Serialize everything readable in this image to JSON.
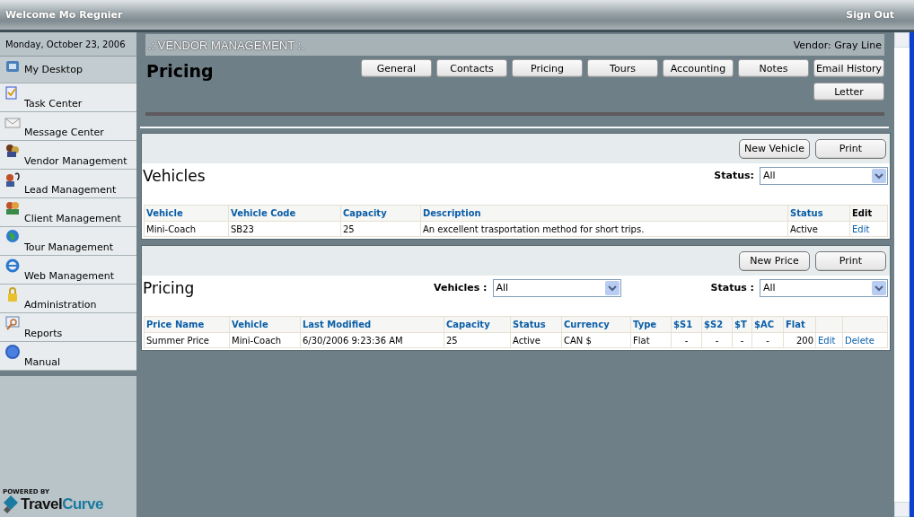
{
  "top_bar": {
    "welcome": "Welcome Mo Regnier",
    "sign_out": "Sign Out"
  },
  "sidebar": {
    "date": "Monday, October 23, 2006",
    "items": [
      {
        "label": "My Desktop",
        "selected": true
      },
      {
        "label": "Task Center",
        "selected": false
      },
      {
        "label": "Message Center",
        "selected": false
      },
      {
        "label": "Vendor Management",
        "selected": false
      },
      {
        "label": "Lead Management",
        "selected": false
      },
      {
        "label": "Client Management",
        "selected": false
      },
      {
        "label": "Tour Management",
        "selected": false
      },
      {
        "label": "Web Management",
        "selected": false
      },
      {
        "label": "Administration",
        "selected": false
      },
      {
        "label": "Reports",
        "selected": false
      },
      {
        "label": "Manual",
        "selected": false
      }
    ],
    "logo": {
      "caption": "POWERED BY",
      "parts": [
        "Travel",
        "Curve"
      ]
    }
  },
  "header": {
    "section": ".: VENDOR MANAGEMENT :.",
    "vendor": "Vendor: Gray Line",
    "title": "Pricing",
    "tabs": [
      "General",
      "Contacts",
      "Pricing",
      "Tours",
      "Accounting",
      "Notes",
      "Email History",
      "Letter"
    ]
  },
  "vehicles": {
    "buttons": [
      "New Vehicle",
      "Print"
    ],
    "title": "Vehicles",
    "filters": [
      {
        "label": "Status:",
        "value": "All"
      }
    ],
    "columns": [
      {
        "label": "Vehicle",
        "kind": "text"
      },
      {
        "label": "Vehicle Code",
        "kind": "text"
      },
      {
        "label": "Capacity",
        "kind": "text"
      },
      {
        "label": "Description",
        "kind": "text"
      },
      {
        "label": "Status",
        "kind": "text"
      },
      {
        "label": "Edit",
        "kind": "action"
      }
    ],
    "rows": [
      [
        "Mini-Coach",
        "SB23",
        "25",
        "An excellent trasportation method for short trips.",
        "Active",
        "Edit"
      ]
    ]
  },
  "pricing": {
    "buttons": [
      "New Price",
      "Print"
    ],
    "title": "Pricing",
    "filters": [
      {
        "label": "Vehicles :",
        "value": "All"
      },
      {
        "label": "Status :",
        "value": "All"
      }
    ],
    "columns": [
      {
        "label": "Price Name",
        "kind": "text"
      },
      {
        "label": "Vehicle",
        "kind": "text"
      },
      {
        "label": "Last Modified",
        "kind": "text"
      },
      {
        "label": "Capacity",
        "kind": "text"
      },
      {
        "label": "Status",
        "kind": "text"
      },
      {
        "label": "Currency",
        "kind": "text"
      },
      {
        "label": "Type",
        "kind": "text"
      },
      {
        "label": "$S1",
        "kind": "rate"
      },
      {
        "label": "$S2",
        "kind": "rate"
      },
      {
        "label": "$T",
        "kind": "rate"
      },
      {
        "label": "$AC",
        "kind": "rate"
      },
      {
        "label": "Flat",
        "kind": "total"
      },
      {
        "kind": "action"
      },
      {
        "kind": "action"
      }
    ],
    "rows": [
      [
        "Summer Price",
        "Mini-Coach",
        "6/30/2006 9:23:36 AM",
        "25",
        "Active",
        "CAN $",
        "Flat",
        "-",
        "-",
        "-",
        "-",
        "200",
        "Edit",
        "Delete"
      ]
    ]
  }
}
